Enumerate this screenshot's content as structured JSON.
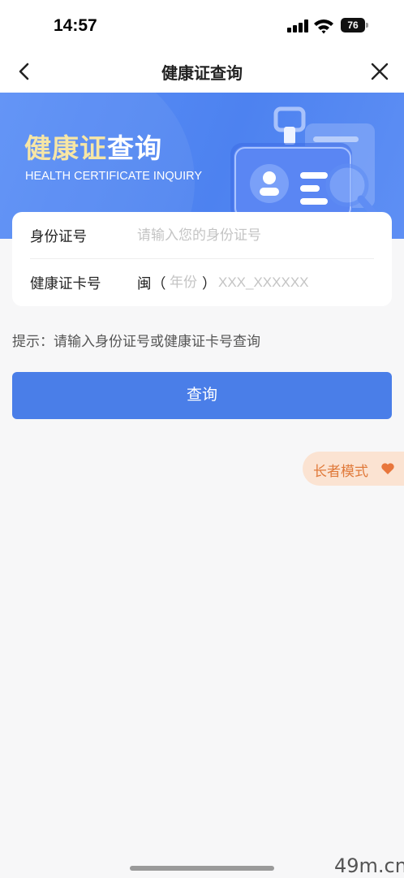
{
  "status_bar": {
    "time": "14:57",
    "battery": "76",
    "signal_icon": "cellular-signal-icon",
    "wifi_icon": "wifi-icon"
  },
  "nav": {
    "title": "健康证查询",
    "back_icon": "chevron-left-icon",
    "close_icon": "close-icon"
  },
  "banner": {
    "title_highlight": "健康证",
    "title_rest": "查询",
    "subtitle": "HEALTH CERTIFICATE INQUIRY",
    "illustration": "id-card-search-illustration"
  },
  "form": {
    "id_number": {
      "label": "身份证号",
      "value": "",
      "placeholder": "请输入您的身份证号"
    },
    "card_number": {
      "label": "健康证卡号",
      "prefix": "闽",
      "paren_open": "（",
      "paren_close": "）",
      "year_placeholder": "年份",
      "year_value": "",
      "number_placeholder": "XXX_XXXXXX",
      "number_value": ""
    }
  },
  "hint": "提示：请输入身份证号或健康证卡号查询",
  "query_button": "查询",
  "elder_mode": {
    "label": "长者模式",
    "icon": "heart-icon"
  },
  "watermark": "49m.cn",
  "colors": {
    "primary": "#4a7ee8",
    "banner": "#5b8ff6",
    "banner_title_gold": "#f7e6a5",
    "elder_bg": "#fbe3d2",
    "elder_text": "#e07a3b",
    "heart": "#e8763c"
  }
}
